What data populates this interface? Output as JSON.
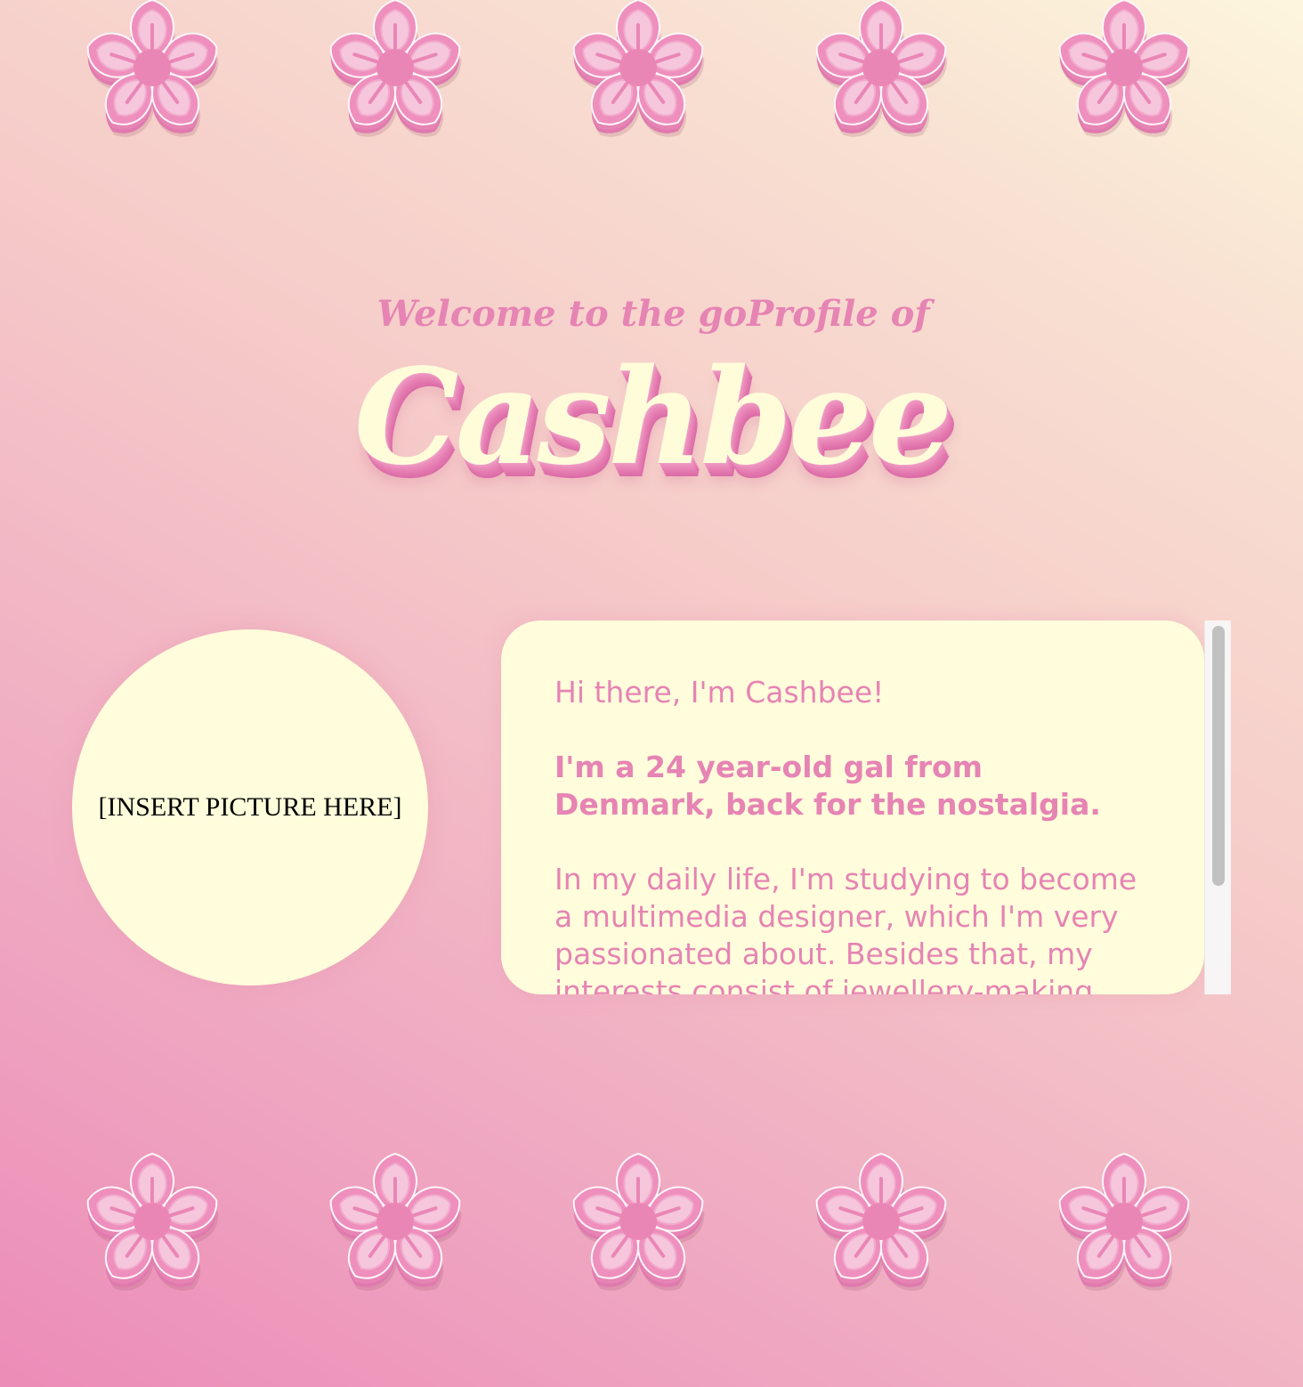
{
  "header": {
    "welcome": "Welcome to the goProfile of",
    "name": "Cashbee"
  },
  "profile_picture": {
    "label": "[INSERT PICTURE HERE]"
  },
  "bio": {
    "greeting": "Hi there, I'm Cashbee!",
    "intro": "I'm a 24 year-old gal from Denmark, back for the nostalgia.",
    "details": "In my daily life, I'm studying to become a multimedia designer, which I'm very passionated about. Besides that, my interests consist of jewellery-making"
  },
  "decorations": {
    "flower_icon": "pink-five-petal-flower",
    "flowers_per_row": 5,
    "rows": [
      "top",
      "bottom"
    ]
  },
  "colors": {
    "accent_pink": "#e684b4",
    "cream": "#fffddb",
    "petal_light": "#f5c6dc",
    "flower_center": "#ea86b6"
  }
}
